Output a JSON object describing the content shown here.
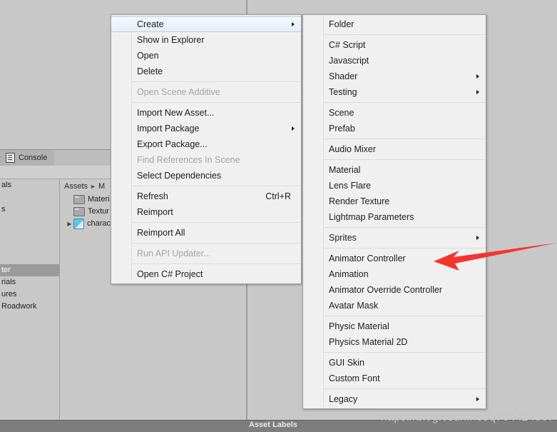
{
  "editor": {
    "console_tab_label": "Console",
    "project_panel": {
      "breadcrumb": {
        "root": "Assets",
        "separator": "►",
        "current": "M"
      },
      "tree_items": [
        {
          "label": "als",
          "selected": false
        },
        {
          "label": "",
          "selected": false
        },
        {
          "label": "s",
          "selected": false
        },
        {
          "label": "",
          "selected": false
        },
        {
          "label": "",
          "selected": false
        },
        {
          "label": "",
          "selected": false
        },
        {
          "label": "",
          "selected": false
        },
        {
          "label": "ter",
          "selected": true
        },
        {
          "label": "rials",
          "selected": false
        },
        {
          "label": "ures",
          "selected": false
        },
        {
          "label": "Roadwork",
          "selected": false
        }
      ],
      "assets": [
        {
          "label": "Materi",
          "icon": "folder-icon",
          "expandable": false
        },
        {
          "label": "Textur",
          "icon": "folder-icon",
          "expandable": false
        },
        {
          "label": "charac",
          "icon": "prefab-icon",
          "expandable": true
        }
      ]
    },
    "asset_labels_text": "Asset Labels"
  },
  "context_menu": {
    "name": "project-context-menu",
    "items": [
      {
        "label": "Create",
        "type": "item",
        "submenu": true,
        "highlighted": true,
        "disabled": false
      },
      {
        "label": "Show in Explorer",
        "type": "item",
        "submenu": false,
        "disabled": false
      },
      {
        "label": "Open",
        "type": "item",
        "submenu": false,
        "disabled": false
      },
      {
        "label": "Delete",
        "type": "item",
        "submenu": false,
        "disabled": false
      },
      {
        "type": "separator"
      },
      {
        "label": "Open Scene Additive",
        "type": "item",
        "submenu": false,
        "disabled": true
      },
      {
        "type": "separator"
      },
      {
        "label": "Import New Asset...",
        "type": "item",
        "submenu": false,
        "disabled": false
      },
      {
        "label": "Import Package",
        "type": "item",
        "submenu": true,
        "disabled": false
      },
      {
        "label": "Export Package...",
        "type": "item",
        "submenu": false,
        "disabled": false
      },
      {
        "label": "Find References In Scene",
        "type": "item",
        "submenu": false,
        "disabled": true
      },
      {
        "label": "Select Dependencies",
        "type": "item",
        "submenu": false,
        "disabled": false
      },
      {
        "type": "separator"
      },
      {
        "label": "Refresh",
        "type": "item",
        "submenu": false,
        "disabled": false,
        "shortcut": "Ctrl+R"
      },
      {
        "label": "Reimport",
        "type": "item",
        "submenu": false,
        "disabled": false
      },
      {
        "type": "separator"
      },
      {
        "label": "Reimport All",
        "type": "item",
        "submenu": false,
        "disabled": false
      },
      {
        "type": "separator"
      },
      {
        "label": "Run API Updater...",
        "type": "item",
        "submenu": false,
        "disabled": true
      },
      {
        "type": "separator"
      },
      {
        "label": "Open C# Project",
        "type": "item",
        "submenu": false,
        "disabled": false
      }
    ]
  },
  "create_submenu": {
    "name": "create-submenu",
    "items": [
      {
        "label": "Folder",
        "type": "item",
        "submenu": false
      },
      {
        "type": "separator"
      },
      {
        "label": "C# Script",
        "type": "item",
        "submenu": false
      },
      {
        "label": "Javascript",
        "type": "item",
        "submenu": false
      },
      {
        "label": "Shader",
        "type": "item",
        "submenu": true
      },
      {
        "label": "Testing",
        "type": "item",
        "submenu": true
      },
      {
        "type": "separator"
      },
      {
        "label": "Scene",
        "type": "item",
        "submenu": false
      },
      {
        "label": "Prefab",
        "type": "item",
        "submenu": false
      },
      {
        "type": "separator"
      },
      {
        "label": "Audio Mixer",
        "type": "item",
        "submenu": false
      },
      {
        "type": "separator"
      },
      {
        "label": "Material",
        "type": "item",
        "submenu": false
      },
      {
        "label": "Lens Flare",
        "type": "item",
        "submenu": false
      },
      {
        "label": "Render Texture",
        "type": "item",
        "submenu": false
      },
      {
        "label": "Lightmap Parameters",
        "type": "item",
        "submenu": false
      },
      {
        "type": "separator"
      },
      {
        "label": "Sprites",
        "type": "item",
        "submenu": true
      },
      {
        "type": "separator"
      },
      {
        "label": "Animator Controller",
        "type": "item",
        "submenu": false
      },
      {
        "label": "Animation",
        "type": "item",
        "submenu": false
      },
      {
        "label": "Animator Override Controller",
        "type": "item",
        "submenu": false
      },
      {
        "label": "Avatar Mask",
        "type": "item",
        "submenu": false
      },
      {
        "type": "separator"
      },
      {
        "label": "Physic Material",
        "type": "item",
        "submenu": false
      },
      {
        "label": "Physics Material 2D",
        "type": "item",
        "submenu": false
      },
      {
        "type": "separator"
      },
      {
        "label": "GUI Skin",
        "type": "item",
        "submenu": false
      },
      {
        "label": "Custom Font",
        "type": "item",
        "submenu": false
      },
      {
        "type": "separator"
      },
      {
        "label": "Legacy",
        "type": "item",
        "submenu": true
      }
    ]
  },
  "annotation": {
    "arrow_color": "#f4352f",
    "points_at": "Animator Controller"
  },
  "watermark": {
    "text": "https://blog.csdn.net/q764424567"
  },
  "colors": {
    "menu_background": "#f0f0f0",
    "menu_border": "#9e9e9e",
    "highlight_fill": "#e6eef8",
    "highlight_border": "#b8d2ea",
    "disabled_text": "#a4a4a4",
    "editor_background": "#c8c8c8",
    "selected_row": "#9a9a9a"
  }
}
